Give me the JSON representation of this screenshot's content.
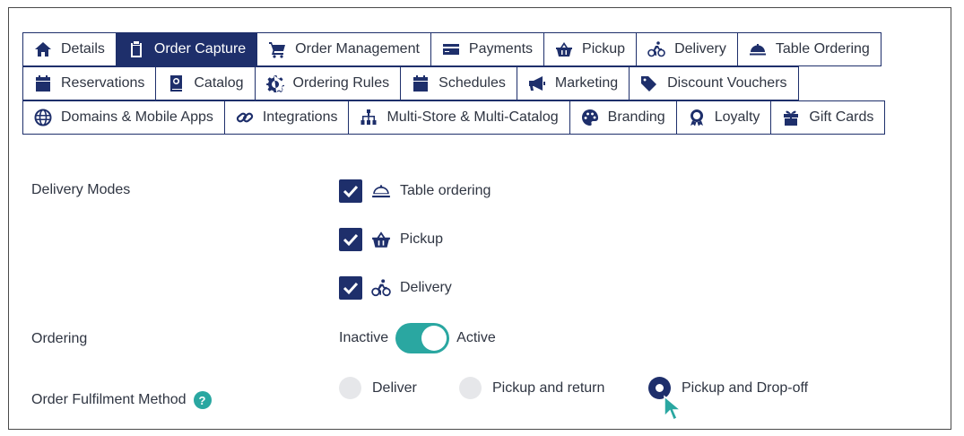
{
  "tabs": {
    "row1": [
      {
        "label": "Details",
        "icon": "home-icon"
      },
      {
        "label": "Order Capture",
        "icon": "clipboard-icon",
        "active": true
      },
      {
        "label": "Order Management",
        "icon": "cart-icon"
      },
      {
        "label": "Payments",
        "icon": "credit-card-icon"
      },
      {
        "label": "Pickup",
        "icon": "basket-icon"
      },
      {
        "label": "Delivery",
        "icon": "bicycle-icon"
      },
      {
        "label": "Table Ordering",
        "icon": "cloche-icon"
      }
    ],
    "row2": [
      {
        "label": "Reservations",
        "icon": "calendar-icon"
      },
      {
        "label": "Catalog",
        "icon": "catalog-book-icon"
      },
      {
        "label": "Ordering Rules",
        "icon": "gear-icon"
      },
      {
        "label": "Schedules",
        "icon": "calendar-icon"
      },
      {
        "label": "Marketing",
        "icon": "megaphone-icon"
      },
      {
        "label": "Discount Vouchers",
        "icon": "tags-icon"
      }
    ],
    "row3": [
      {
        "label": "Domains & Mobile Apps",
        "icon": "globe-icon"
      },
      {
        "label": "Integrations",
        "icon": "link-icon"
      },
      {
        "label": "Multi-Store & Multi-Catalog",
        "icon": "sitemap-icon"
      },
      {
        "label": "Branding",
        "icon": "palette-icon"
      },
      {
        "label": "Loyalty",
        "icon": "award-icon"
      },
      {
        "label": "Gift Cards",
        "icon": "gift-icon"
      }
    ]
  },
  "form": {
    "delivery_modes_label": "Delivery Modes",
    "modes": [
      {
        "label": "Table ordering",
        "checked": true,
        "icon": "cloche-icon"
      },
      {
        "label": "Pickup",
        "checked": true,
        "icon": "basket-icon"
      },
      {
        "label": "Delivery",
        "checked": true,
        "icon": "bicycle-icon"
      }
    ],
    "ordering_label": "Ordering",
    "toggle_off_label": "Inactive",
    "toggle_on_label": "Active",
    "toggle_state": "active",
    "fulfilment_label": "Order Fulfilment Method",
    "help_icon_text": "?",
    "fulfilment_options": [
      {
        "label": "Deliver",
        "selected": false
      },
      {
        "label": "Pickup and return",
        "selected": false
      },
      {
        "label": "Pickup and Drop-off",
        "selected": true
      }
    ]
  },
  "colors": {
    "primary": "#1e2f6b",
    "accent": "#2aa7a1",
    "radio_unselected": "#e6e7ea"
  }
}
